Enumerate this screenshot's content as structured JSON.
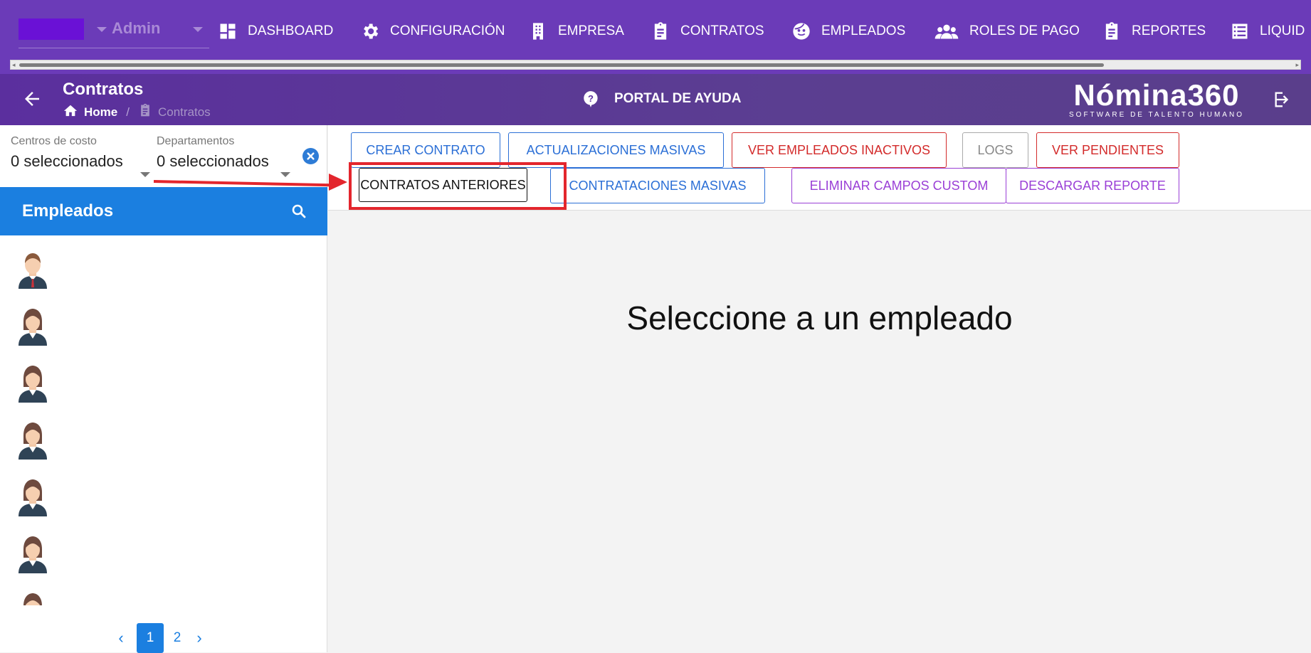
{
  "topnav": {
    "company_role": "Admin",
    "items": [
      {
        "label": "DASHBOARD",
        "icon": "dashboard-icon"
      },
      {
        "label": "CONFIGURACIÓN",
        "icon": "gear-icon"
      },
      {
        "label": "EMPRESA",
        "icon": "building-icon"
      },
      {
        "label": "CONTRATOS",
        "icon": "clipboard-icon"
      },
      {
        "label": "EMPLEADOS",
        "icon": "face-icon"
      },
      {
        "label": "ROLES DE PAGO",
        "icon": "group-icon"
      },
      {
        "label": "REPORTES",
        "icon": "clipboard-icon"
      },
      {
        "label": "LIQUID",
        "icon": "list-icon"
      }
    ]
  },
  "header": {
    "title": "Contratos",
    "breadcrumb_home": "Home",
    "breadcrumb_sep": "/",
    "breadcrumb_current": "Contratos",
    "help_label": "PORTAL DE AYUDA",
    "logo_name": "Nómina360",
    "logo_tagline": "SOFTWARE DE TALENTO HUMANO"
  },
  "filters": {
    "cost_centers_label": "Centros de costo",
    "cost_centers_value": "0 seleccionados",
    "departments_label": "Departamentos",
    "departments_value": "0 seleccionados"
  },
  "employees": {
    "title": "Empleados",
    "avatars": [
      "male",
      "female",
      "female",
      "female",
      "female",
      "female",
      "female"
    ]
  },
  "pagination": {
    "prev": "‹",
    "pages": [
      "1",
      "2"
    ],
    "current": "1",
    "next": "›"
  },
  "toolbar": {
    "crear_contrato": "CREAR CONTRATO",
    "actualizaciones_masivas": "ACTUALIZACIONES MASIVAS",
    "ver_empleados_inactivos": "VER EMPLEADOS INACTIVOS",
    "logs": "LOGS",
    "ver_pendientes": "VER PENDIENTES",
    "contratos_anteriores": "CONTRATOS ANTERIORES",
    "contrataciones_masivas": "CONTRATACIONES MASIVAS",
    "eliminar_campos_custom": "ELIMINAR CAMPOS CUSTOM",
    "descargar_reporte": "DESCARGAR REPORTE"
  },
  "main": {
    "placeholder": "Seleccione a un empleado"
  },
  "colors": {
    "nav_bg": "#6b3bb8",
    "header_bg": "#5b2f9e",
    "employees_header": "#1b7fe0",
    "highlight": "#e3262d"
  }
}
